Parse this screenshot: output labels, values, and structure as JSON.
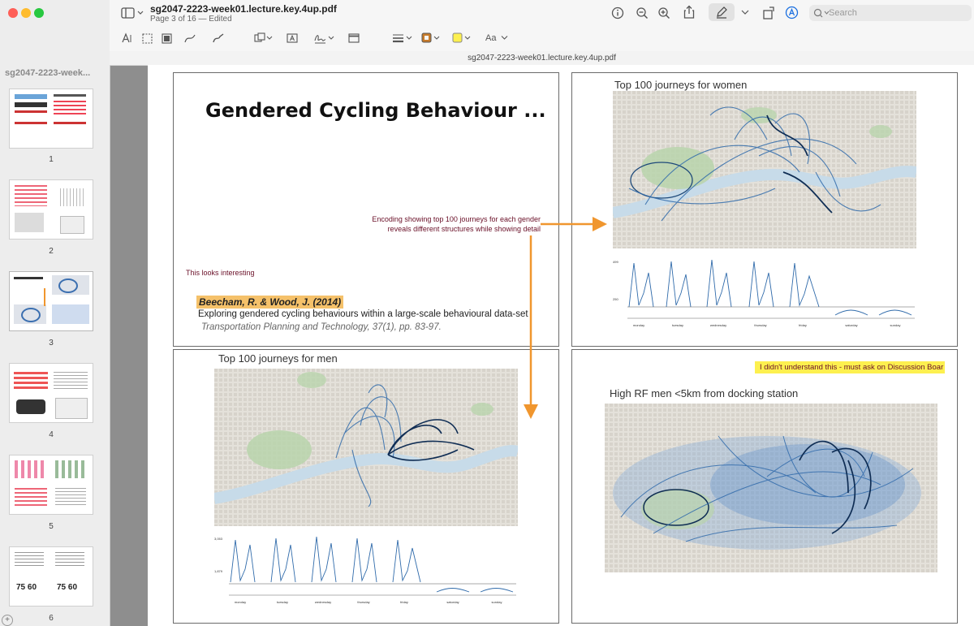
{
  "window": {
    "title": "sg2047-2223-week01.lecture.key.4up.pdf",
    "subtitle": "Page 3 of 16 — Edited",
    "path_label": "sg2047-2223-week01.lecture.key.4up.pdf"
  },
  "sidebar": {
    "title": "sg2047-2223-week...",
    "pages": [
      "1",
      "2",
      "3",
      "4",
      "5",
      "6"
    ]
  },
  "toolbar": {
    "search_placeholder": "Search",
    "text_style_label": "Aa"
  },
  "slides": {
    "s1": {
      "title": "Gendered Cycling Behaviour ...",
      "note_interesting": "This looks interesting",
      "annotation_line1": "Encoding showing top 100 journeys for each gender",
      "annotation_line2": "reveals different structures while showing detail",
      "citation_authors": "Beecham, R. & Wood, J. (2014)",
      "citation_title": "Exploring gendered cycling behaviours within a large-scale behavioural data-set",
      "citation_journal": "Transportation Planning and Technology, 37(1), pp. 83-97."
    },
    "s2": {
      "title": "Top 100 journeys for women",
      "chart_days": [
        "monday",
        "tuesday",
        "wednesday",
        "thursday",
        "friday",
        "saturday",
        "sunday"
      ],
      "y_ticks": [
        "499",
        "250"
      ]
    },
    "s3": {
      "title": "Top 100 journeys for men",
      "chart_days": [
        "monday",
        "tuesday",
        "wednesday",
        "thursday",
        "friday",
        "saturday",
        "sunday"
      ],
      "y_ticks": [
        "3,053",
        "1,879"
      ]
    },
    "s4": {
      "title": "High RF men <5km from docking station",
      "sticky_note": "I didn't understand this - must ask on Discussion Boar"
    }
  },
  "colors": {
    "highlight_yellow": "#fdf04f",
    "highlight_orange": "#f5c16a",
    "annotation_text": "#6a1028",
    "arrow": "#f0962e",
    "journey_blue": "#2f6aaa",
    "accent_blue": "#1a6fe0"
  }
}
